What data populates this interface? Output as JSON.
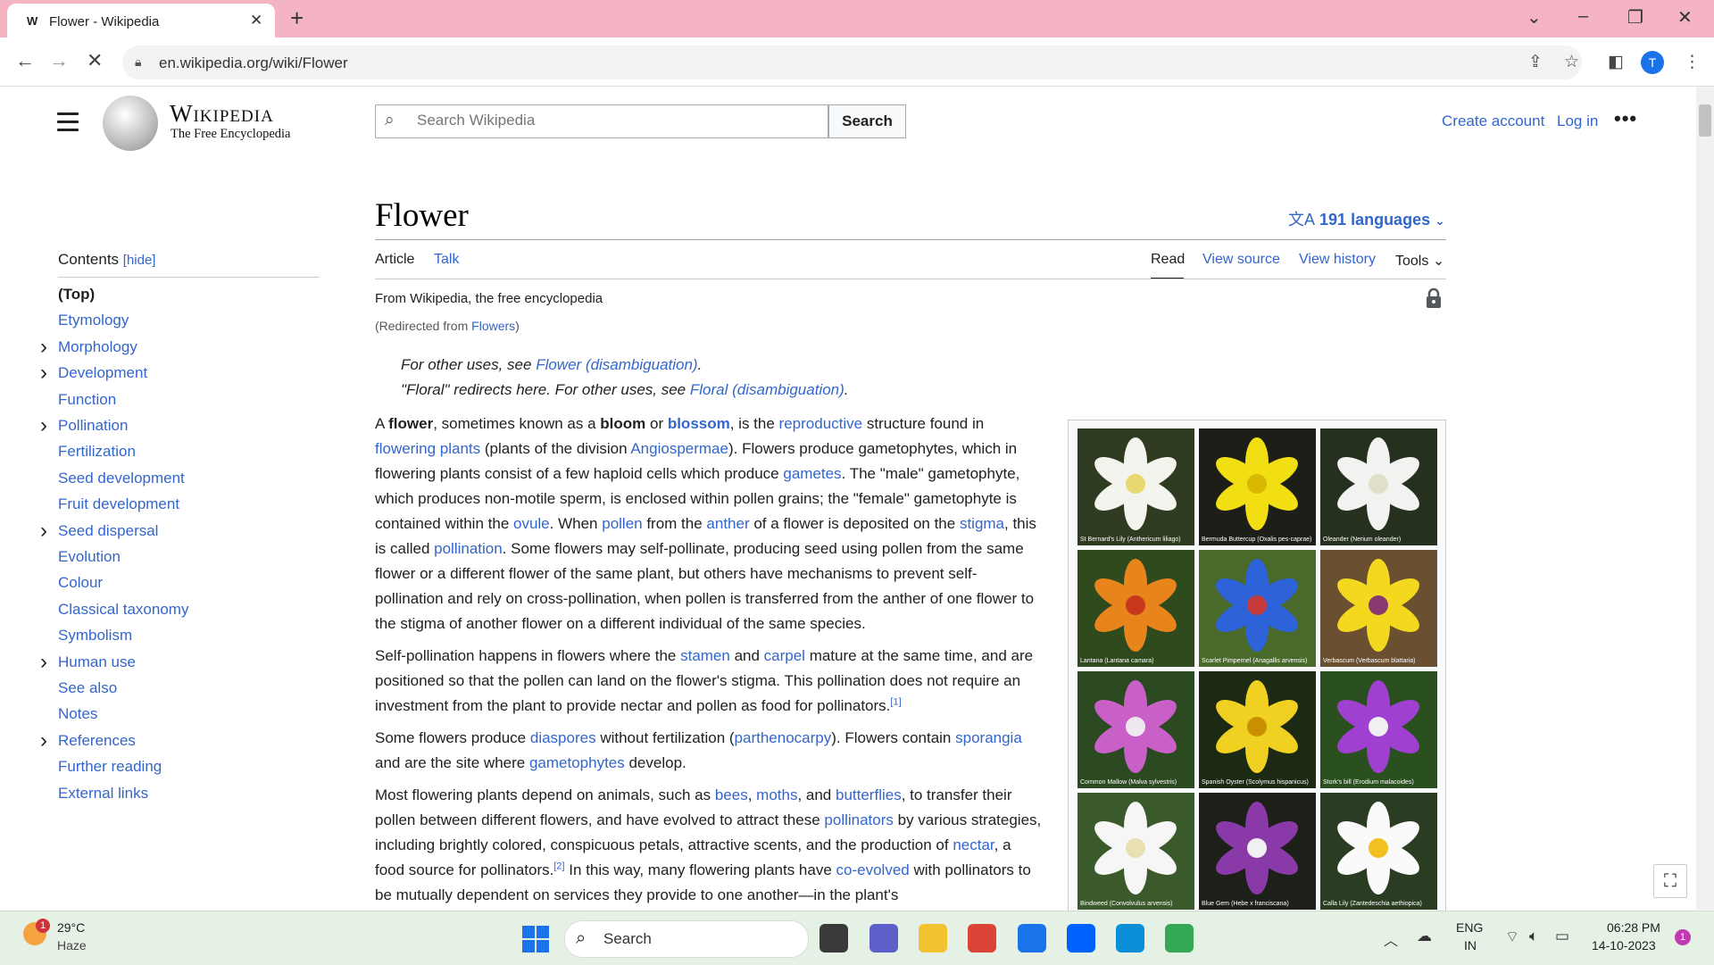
{
  "browser": {
    "tab_title": "Flower - Wikipedia",
    "tab_favicon": "W",
    "url": "en.wikipedia.org/wiki/Flower",
    "profile_initial": "T",
    "icons": [
      "back-icon",
      "forward-icon",
      "stop-loading-icon",
      "lock-icon",
      "share-icon",
      "bookmark-star-icon",
      "side-panel-icon",
      "kebab-menu-icon"
    ]
  },
  "wiki_header": {
    "wordmark": "Wikipedia",
    "tagline": "The Free Encyclopedia",
    "search_placeholder": "Search Wikipedia",
    "search_button": "Search",
    "create_account": "Create account",
    "log_in": "Log in",
    "more": "•••"
  },
  "toc": {
    "heading": "Contents",
    "hide": "[hide]",
    "items": [
      {
        "label": "(Top)",
        "expandable": false
      },
      {
        "label": "Etymology",
        "expandable": false
      },
      {
        "label": "Morphology",
        "expandable": true
      },
      {
        "label": "Development",
        "expandable": true
      },
      {
        "label": "Function",
        "expandable": false
      },
      {
        "label": "Pollination",
        "expandable": true
      },
      {
        "label": "Fertilization",
        "expandable": false
      },
      {
        "label": "Seed development",
        "expandable": false
      },
      {
        "label": "Fruit development",
        "expandable": false
      },
      {
        "label": "Seed dispersal",
        "expandable": true
      },
      {
        "label": "Evolution",
        "expandable": false
      },
      {
        "label": "Colour",
        "expandable": false
      },
      {
        "label": "Classical taxonomy",
        "expandable": false
      },
      {
        "label": "Symbolism",
        "expandable": false
      },
      {
        "label": "Human use",
        "expandable": true
      },
      {
        "label": "See also",
        "expandable": false
      },
      {
        "label": "Notes",
        "expandable": false
      },
      {
        "label": "References",
        "expandable": true
      },
      {
        "label": "Further reading",
        "expandable": false
      },
      {
        "label": "External links",
        "expandable": false
      }
    ]
  },
  "article": {
    "title": "Flower",
    "languages": "191 languages",
    "tabs": {
      "article": "Article",
      "talk": "Talk",
      "read": "Read",
      "view_source": "View source",
      "view_history": "View history",
      "tools": "Tools"
    },
    "from": "From Wikipedia, the free encyclopedia",
    "redirect_prefix": "(Redirected from ",
    "redirect_link": "Flowers",
    "redirect_suffix": ")",
    "hatnote1_prefix": "For other uses, see ",
    "hatnote1_link": "Flower (disambiguation)",
    "hatnote1_suffix": ".",
    "hatnote2_prefix": "\"Floral\" redirects here. For other uses, see ",
    "hatnote2_link": "Floral (disambiguation)",
    "hatnote2_suffix": ".",
    "paragraphs": [
      [
        {
          "t": "A "
        },
        {
          "t": "flower",
          "b": true
        },
        {
          "t": ", sometimes known as a "
        },
        {
          "t": "bloom",
          "b": true
        },
        {
          "t": " or "
        },
        {
          "t": "blossom",
          "b": true,
          "link": true
        },
        {
          "t": ", is the "
        },
        {
          "t": "reproductive",
          "link": true
        },
        {
          "t": " structure found in "
        },
        {
          "t": "flowering plants",
          "link": true
        },
        {
          "t": " (plants of the division "
        },
        {
          "t": "Angiospermae",
          "link": true
        },
        {
          "t": "). Flowers produce gametophytes, which in flowering plants consist of a few haploid cells which produce "
        },
        {
          "t": "gametes",
          "link": true
        },
        {
          "t": ". The \"male\" gametophyte, which produces non-motile sperm, is enclosed within pollen grains; the \"female\" gametophyte is contained within the "
        },
        {
          "t": "ovule",
          "link": true
        },
        {
          "t": ". When "
        },
        {
          "t": "pollen",
          "link": true
        },
        {
          "t": " from the "
        },
        {
          "t": "anther",
          "link": true
        },
        {
          "t": " of a flower is deposited on the "
        },
        {
          "t": "stigma",
          "link": true
        },
        {
          "t": ", this is called "
        },
        {
          "t": "pollination",
          "link": true
        },
        {
          "t": ". Some flowers may self-pollinate, producing seed using pollen from the same flower or a different flower of the same plant, but others have mechanisms to prevent self-pollination and rely on cross-pollination, when pollen is transferred from the anther of one flower to the stigma of another flower on a different individual of the same species."
        }
      ],
      [
        {
          "t": "Self-pollination happens in flowers where the "
        },
        {
          "t": "stamen",
          "link": true
        },
        {
          "t": " and "
        },
        {
          "t": "carpel",
          "link": true
        },
        {
          "t": " mature at the same time, and are positioned so that the pollen can land on the flower's stigma. This pollination does not require an investment from the plant to provide nectar and pollen as food for pollinators."
        },
        {
          "t": "[1]",
          "sup": true
        }
      ],
      [
        {
          "t": "Some flowers produce "
        },
        {
          "t": "diaspores",
          "link": true
        },
        {
          "t": " without fertilization ("
        },
        {
          "t": "parthenocarpy",
          "link": true
        },
        {
          "t": "). Flowers contain "
        },
        {
          "t": "sporangia",
          "link": true
        },
        {
          "t": " and are the site where "
        },
        {
          "t": "gametophytes",
          "link": true
        },
        {
          "t": " develop."
        }
      ],
      [
        {
          "t": "Most flowering plants depend on animals, such as "
        },
        {
          "t": "bees",
          "link": true
        },
        {
          "t": ", "
        },
        {
          "t": "moths",
          "link": true
        },
        {
          "t": ", and "
        },
        {
          "t": "butterflies",
          "link": true
        },
        {
          "t": ", to transfer their pollen between different flowers, and have evolved to attract these "
        },
        {
          "t": "pollinators",
          "link": true
        },
        {
          "t": " by various strategies, including brightly colored, conspicuous petals, attractive scents, and the production of "
        },
        {
          "t": "nectar",
          "link": true
        },
        {
          "t": ", a food source for pollinators."
        },
        {
          "t": "[2]",
          "sup": true
        },
        {
          "t": " In this way, many flowering plants have "
        },
        {
          "t": "co-evolved",
          "link": true
        },
        {
          "t": " with pollinators to be mutually dependent on services they provide to one another—in the plant's"
        }
      ]
    ],
    "gallery": [
      {
        "caption": "St Bernard's Lily (Anthericum liliago)",
        "bg": "#2f3b20",
        "petal": "#f4f4ee",
        "center": "#e8d870"
      },
      {
        "caption": "Bermuda Buttercup (Oxalis pes-caprae)",
        "bg": "#1e1e18",
        "petal": "#f1df14",
        "center": "#d8b800"
      },
      {
        "caption": "Oleander (Nerium oleander)",
        "bg": "#26301e",
        "petal": "#f2f2f0",
        "center": "#e0e0c8"
      },
      {
        "caption": "Lantana (Lantana camara)",
        "bg": "#2f4a1c",
        "petal": "#e8841c",
        "center": "#c8381c"
      },
      {
        "caption": "Scarlet Pimpernel (Anagallis arvensis)",
        "bg": "#4a6a2c",
        "petal": "#2e62d8",
        "center": "#c63c3c"
      },
      {
        "caption": "Verbascum (Verbascum blattaria)",
        "bg": "#6a5030",
        "petal": "#f4d820",
        "center": "#8a3a70"
      },
      {
        "caption": "Common Mallow (Malva sylvestris)",
        "bg": "#2c4a22",
        "petal": "#c860c8",
        "center": "#f0e8f0"
      },
      {
        "caption": "Spanish Oyster (Scolymus hispanicus)",
        "bg": "#1c2a14",
        "petal": "#f0d020",
        "center": "#c89000"
      },
      {
        "caption": "Stork's bill (Erodium malacoides)",
        "bg": "#2a5020",
        "petal": "#a040d0",
        "center": "#f0f0f0"
      },
      {
        "caption": "Bindweed (Convolvulus arvensis)",
        "bg": "#3a5a2c",
        "petal": "#f6f6f6",
        "center": "#e8e0b0"
      },
      {
        "caption": "Blue Gem (Hebe x franciscana)",
        "bg": "#1c2018",
        "petal": "#8a3aa8",
        "center": "#f0f0f0"
      },
      {
        "caption": "Calla Lily (Zantedeschia aethiopica)",
        "bg": "#2a3c22",
        "petal": "#fafafa",
        "center": "#f2c020"
      }
    ]
  },
  "taskbar": {
    "temperature": "29°C",
    "weather": "Haze",
    "weather_badge": "1",
    "search_label": "Search",
    "language_line1": "ENG",
    "language_line2": "IN",
    "time": "06:28 PM",
    "date": "14-10-2023",
    "notification_count": "1",
    "apps": [
      {
        "name": "task-view-icon",
        "color": "#3a3a3a"
      },
      {
        "name": "teams-chat-icon",
        "color": "#5b5fc7"
      },
      {
        "name": "file-explorer-icon",
        "color": "#f2c230"
      },
      {
        "name": "chrome-icon",
        "color": "#db4437"
      },
      {
        "name": "mail-icon",
        "color": "#1a73e8"
      },
      {
        "name": "dropbox-icon",
        "color": "#0061fe"
      },
      {
        "name": "edge-icon",
        "color": "#0c8ed9"
      },
      {
        "name": "chrome-profile-icon",
        "color": "#34a853"
      }
    ]
  },
  "colors": {
    "link": "#3366cc",
    "tabbar": "#f4b4c4",
    "taskbar": "#e6f1e6"
  }
}
